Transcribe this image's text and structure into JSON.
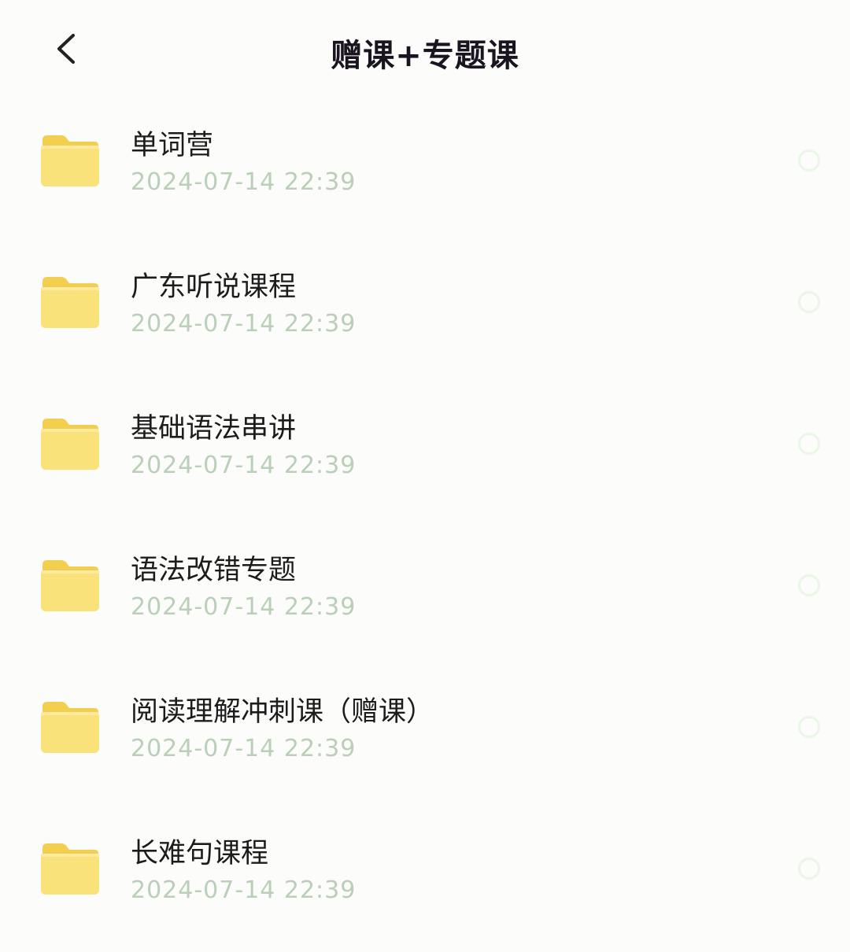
{
  "header": {
    "title": "赠课+专题课",
    "back_icon": "chevron-left-icon"
  },
  "colors": {
    "background": "#fcfcfa",
    "folder": "#f9e27a",
    "date_text": "#b9cfb7",
    "radio_border": "#eaf6e6"
  },
  "files": [
    {
      "name": "单词营",
      "date": "2024-07-14 22:39",
      "icon": "folder-icon"
    },
    {
      "name": "广东听说课程",
      "date": "2024-07-14 22:39",
      "icon": "folder-icon"
    },
    {
      "name": "基础语法串讲",
      "date": "2024-07-14 22:39",
      "icon": "folder-icon"
    },
    {
      "name": "语法改错专题",
      "date": "2024-07-14 22:39",
      "icon": "folder-icon"
    },
    {
      "name": "阅读理解冲刺课（赠课）",
      "date": "2024-07-14 22:39",
      "icon": "folder-icon"
    },
    {
      "name": "长难句课程",
      "date": "2024-07-14 22:39",
      "icon": "folder-icon"
    }
  ]
}
